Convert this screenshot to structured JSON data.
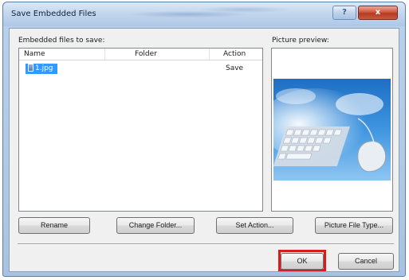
{
  "window": {
    "title": "Save Embedded Files",
    "help_label": "?",
    "close_label": "x"
  },
  "files_section": {
    "label": "Embedded files to save:",
    "columns": {
      "name": "Name",
      "folder": "Folder",
      "action": "Action"
    },
    "rows": [
      {
        "name": "1.jpg",
        "folder": "",
        "action": "Save",
        "selected": true
      }
    ]
  },
  "preview_section": {
    "label": "Picture preview:",
    "image": "keyboard-mouse-cloud-image"
  },
  "buttons": {
    "rename": "Rename",
    "change_folder": "Change Folder...",
    "set_action": "Set Action...",
    "picture_file_type": "Picture File Type...",
    "ok": "OK",
    "cancel": "Cancel"
  },
  "colors": {
    "selection": "#3399ff",
    "highlight_outline": "#d81b1b"
  }
}
